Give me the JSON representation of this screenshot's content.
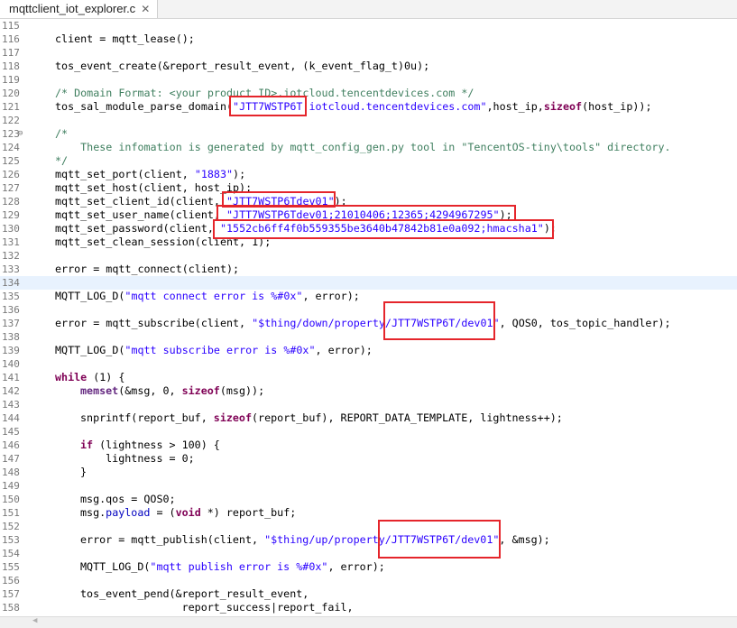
{
  "tab": {
    "title": "mqttclient_iot_explorer.c",
    "close_glyph": "✕"
  },
  "scroll_left_glyph": "◀",
  "fold_glyph": "⊖",
  "line_numbers": [
    "115",
    "116",
    "117",
    "118",
    "119",
    "120",
    "121",
    "122",
    "123",
    "124",
    "125",
    "126",
    "127",
    "128",
    "129",
    "130",
    "131",
    "132",
    "133",
    "134",
    "135",
    "136",
    "137",
    "138",
    "139",
    "140",
    "141",
    "142",
    "143",
    "144",
    "145",
    "146",
    "147",
    "148",
    "149",
    "150",
    "151",
    "152",
    "153",
    "154",
    "155",
    "156",
    "157",
    "158"
  ],
  "code": {
    "l116": {
      "a": "client = mqtt_lease();"
    },
    "l118": {
      "a": "tos_event_create(&report_result_event, (k_event_flag_t)0u);"
    },
    "l120": {
      "a": "/* Domain Format: <your product ID>.iotcloud.tencentdevices.com */"
    },
    "l121": {
      "a": "tos_sal_module_parse_domain(",
      "s": "\"JTT7WSTP6T.iotcloud.tencentdevices.com\"",
      "b": ",host_ip,",
      "k": "sizeof",
      "c": "(host_ip));"
    },
    "l123": {
      "a": "/*"
    },
    "l124": {
      "a": "    These infomation is generated by mqtt_config_gen.py tool in \"TencentOS-tiny\\tools\" directory."
    },
    "l125": {
      "a": "*/"
    },
    "l126": {
      "a": "mqtt_set_port(client, ",
      "s": "\"1883\"",
      "b": ");"
    },
    "l127": {
      "a": "mqtt_set_host(client, host_ip);"
    },
    "l128": {
      "a": "mqtt_set_client_id(client, ",
      "s": "\"JTT7WSTP6Tdev01\"",
      "b": ");"
    },
    "l129": {
      "a": "mqtt_set_user_name(client, ",
      "s": "\"JTT7WSTP6Tdev01;21010406;12365;4294967295\"",
      "b": ");"
    },
    "l130": {
      "a": "mqtt_set_password(client, ",
      "s": "\"1552cb6ff4f0b559355be3640b47842b81e0a092;hmacsha1\"",
      "b": ");"
    },
    "l131": {
      "a": "mqtt_set_clean_session(client, 1);"
    },
    "l133": {
      "a": "error = mqtt_connect(client);"
    },
    "l135": {
      "a": "MQTT_LOG_D(",
      "s": "\"mqtt connect error is %#0x\"",
      "b": ", error);"
    },
    "l137": {
      "a": "error = mqtt_subscribe(client, ",
      "s": "\"$thing/down/property/JTT7WSTP6T/dev01\"",
      "b": ", QOS0, tos_topic_handler);"
    },
    "l139": {
      "a": "MQTT_LOG_D(",
      "s": "\"mqtt subscribe error is %#0x\"",
      "b": ", error);"
    },
    "l141": {
      "k": "while",
      "a": " (1) {"
    },
    "l142": {
      "f": "memset",
      "a": "(&msg, 0, ",
      "k": "sizeof",
      "b": "(msg));"
    },
    "l144": {
      "a": "snprintf(report_buf, ",
      "k": "sizeof",
      "b": "(report_buf), REPORT_DATA_TEMPLATE, lightness++);"
    },
    "l146": {
      "k": "if",
      "a": " (lightness > 100) {"
    },
    "l147": {
      "a": "    lightness = 0;"
    },
    "l148": {
      "a": "}"
    },
    "l150": {
      "a": "msg.qos = QOS0;"
    },
    "l151": {
      "a": "msg.",
      "f": "payload",
      "b": " = (",
      "k": "void",
      "c": " *) report_buf;"
    },
    "l153": {
      "a": "error = mqtt_publish(client, ",
      "s": "\"$thing/up/property/JTT7WSTP6T/dev01\"",
      "b": ", &msg);"
    },
    "l155": {
      "a": "MQTT_LOG_D(",
      "s": "\"mqtt publish error is %#0x\"",
      "b": ", error);"
    },
    "l157": {
      "a": "tos_event_pend(&report_result_event,"
    },
    "l158": {
      "a": "                report_success|report_fail,"
    }
  }
}
